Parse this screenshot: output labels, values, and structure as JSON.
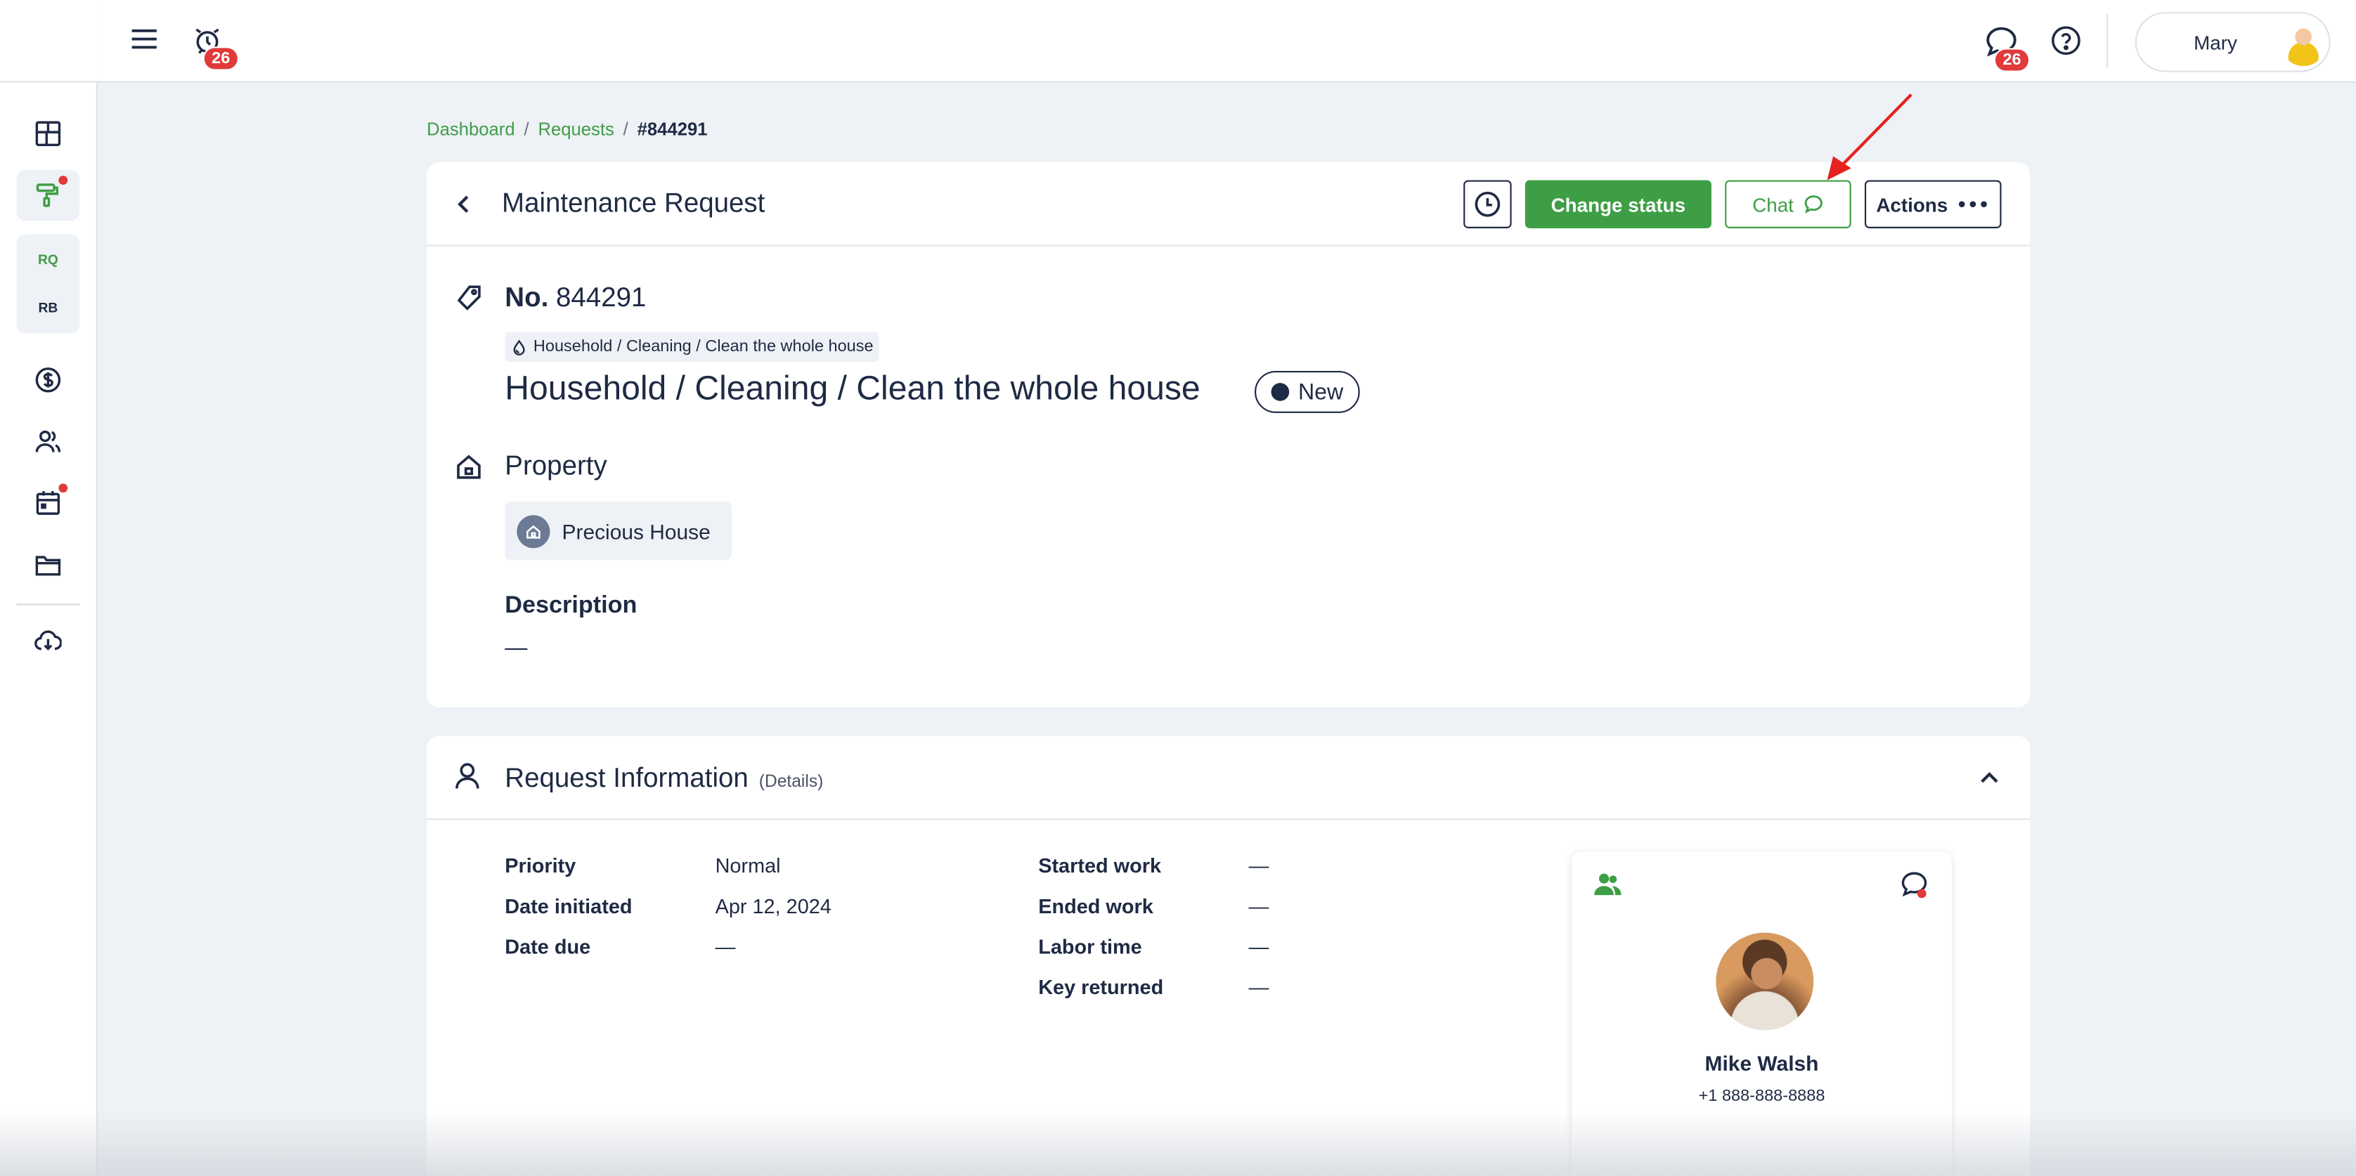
{
  "topbar": {
    "alarm_badge": "26",
    "chat_badge": "26",
    "user_name": "Mary"
  },
  "sidebar": {
    "items": [
      {
        "icon": "dashboard-icon"
      },
      {
        "icon": "maintenance-roller-icon",
        "active": true,
        "dot": true
      },
      {
        "label": "RQ"
      },
      {
        "label": "RB"
      },
      {
        "icon": "dollar-icon"
      },
      {
        "icon": "people-icon"
      },
      {
        "icon": "calendar-icon",
        "dot": true
      },
      {
        "icon": "folder-icon"
      },
      {
        "icon": "cloud-download-icon"
      }
    ]
  },
  "breadcrumb": {
    "items": [
      "Dashboard",
      "Requests"
    ],
    "separator": "/",
    "current": "#844291"
  },
  "request": {
    "title": "Maintenance Request",
    "buttons": {
      "change_status": "Change status",
      "chat": "Chat",
      "actions": "Actions"
    },
    "number_label": "No.",
    "number": "844291",
    "category_chip": "Household / Cleaning / Clean the whole house",
    "heading": "Household / Cleaning / Clean the whole house",
    "status": "New",
    "property_label": "Property",
    "property_name": "Precious House",
    "description_label": "Description",
    "description_value": "—"
  },
  "info": {
    "title": "Request Information",
    "subtitle": "(Details)",
    "left_fields": [
      {
        "label": "Priority",
        "value": "Normal"
      },
      {
        "label": "Date initiated",
        "value": "Apr 12, 2024"
      },
      {
        "label": "Date due",
        "value": "—"
      }
    ],
    "right_fields": [
      {
        "label": "Started work",
        "value": "—"
      },
      {
        "label": "Ended work",
        "value": "—"
      },
      {
        "label": "Labor time",
        "value": "—"
      },
      {
        "label": "Key returned",
        "value": "—"
      }
    ],
    "contact": {
      "name": "Mike Walsh",
      "phone": "+1 888-888-8888"
    }
  },
  "colors": {
    "accent_green": "#3d9e45",
    "text_navy": "#1f2a44",
    "badge_red": "#e03a3a",
    "page_bg": "#eef1f5"
  }
}
